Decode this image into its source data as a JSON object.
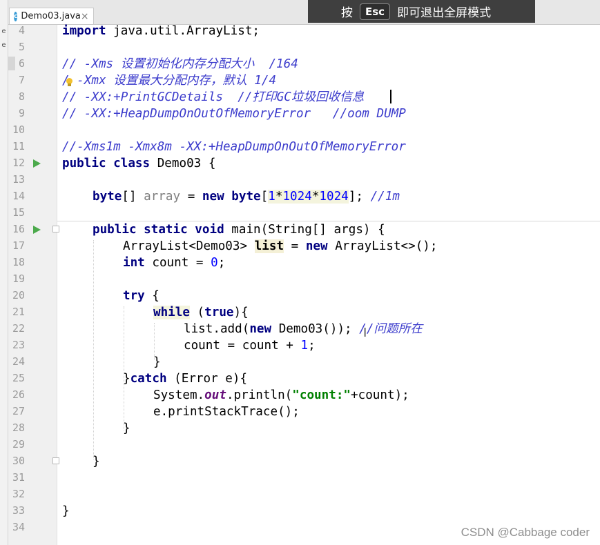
{
  "editor": {
    "tab": {
      "filename": "Demo03.java",
      "icon_letter": "c",
      "close": "×"
    },
    "left_glyphs": [
      "e",
      "e"
    ],
    "overlay": {
      "press": "按",
      "key": "Esc",
      "exit_text": "即可退出全屏模式"
    },
    "line_numbers": [
      "4",
      "5",
      "6",
      "7",
      "8",
      "9",
      "10",
      "11",
      "12",
      "13",
      "14",
      "15",
      "16",
      "17",
      "18",
      "19",
      "20",
      "21",
      "22",
      "23",
      "24",
      "25",
      "26",
      "27",
      "28",
      "29",
      "30",
      "31",
      "32",
      "33",
      "34"
    ],
    "gutter_markers": [
      {
        "line": "12",
        "marker": "run-arrow-icon"
      },
      {
        "line": "16",
        "marker": "run-arrow-icon"
      }
    ],
    "code": {
      "l4": {
        "kw": "import",
        "rest": " java.util.ArrayList;"
      },
      "l6": "// -Xms 设置初始化内存分配大小  /164",
      "l7": {
        "prefix": "/",
        "rest": " -Xmx 设置最大分配内存，默认 1/4"
      },
      "l8": "// -XX:+PrintGCDetails  //打印GC垃圾回收信息",
      "l9": "// -XX:+HeapDumpOnOutOfMemoryError   //oom DUMP",
      "l11": "//-Xms1m -Xmx8m -XX:+HeapDumpOnOutOfMemoryError",
      "l12": {
        "kw": "public class",
        "rest": " Demo03 {"
      },
      "l14": {
        "kw1": "byte",
        "t1": "[] ",
        "var": "array",
        "t2": " = ",
        "kw2": "new",
        "t3": " ",
        "kw3": "byte",
        "t4": "[",
        "n1": "1",
        "op1": "*",
        "n2": "1024",
        "op2": "*",
        "n3": "1024",
        "t5": "]; ",
        "cm": "//1m"
      },
      "l16": {
        "kw": "public static void",
        "rest": " main(String[] args) {"
      },
      "l17": {
        "t1": "ArrayList<Demo03> ",
        "var": "list",
        "t2": " = ",
        "kw": "new",
        "t3": " ArrayList<>();"
      },
      "l18": {
        "kw": "int",
        "t1": " count = ",
        "num": "0",
        "t2": ";"
      },
      "l20": {
        "kw": "try",
        "rest": " {"
      },
      "l21": {
        "kw": "while",
        "t1": " (",
        "kw2": "true",
        "t2": "){"
      },
      "l22": {
        "t1": "list.add(",
        "kw": "new",
        "t2": " Demo03()); ",
        "cm": "//问题所在"
      },
      "l23": {
        "t1": "count = count + ",
        "num": "1",
        "t2": ";"
      },
      "l24": "}",
      "l25": {
        "t1": "}",
        "kw": "catch",
        "t2": " (Error e){"
      },
      "l26": {
        "t1": "System.",
        "fld": "out",
        "t2": ".println(",
        "str": "\"count:\"",
        "t3": "+count);"
      },
      "l27": "e.printStackTrace();",
      "l28": "}",
      "l30": "}",
      "l33": "}"
    }
  },
  "watermark": "CSDN @Cabbage coder",
  "colors": {
    "keyword": "#000080",
    "comment": "#3c3ccc",
    "number": "#0000ff",
    "string": "#008000",
    "run_icon": "#4caa4c"
  }
}
